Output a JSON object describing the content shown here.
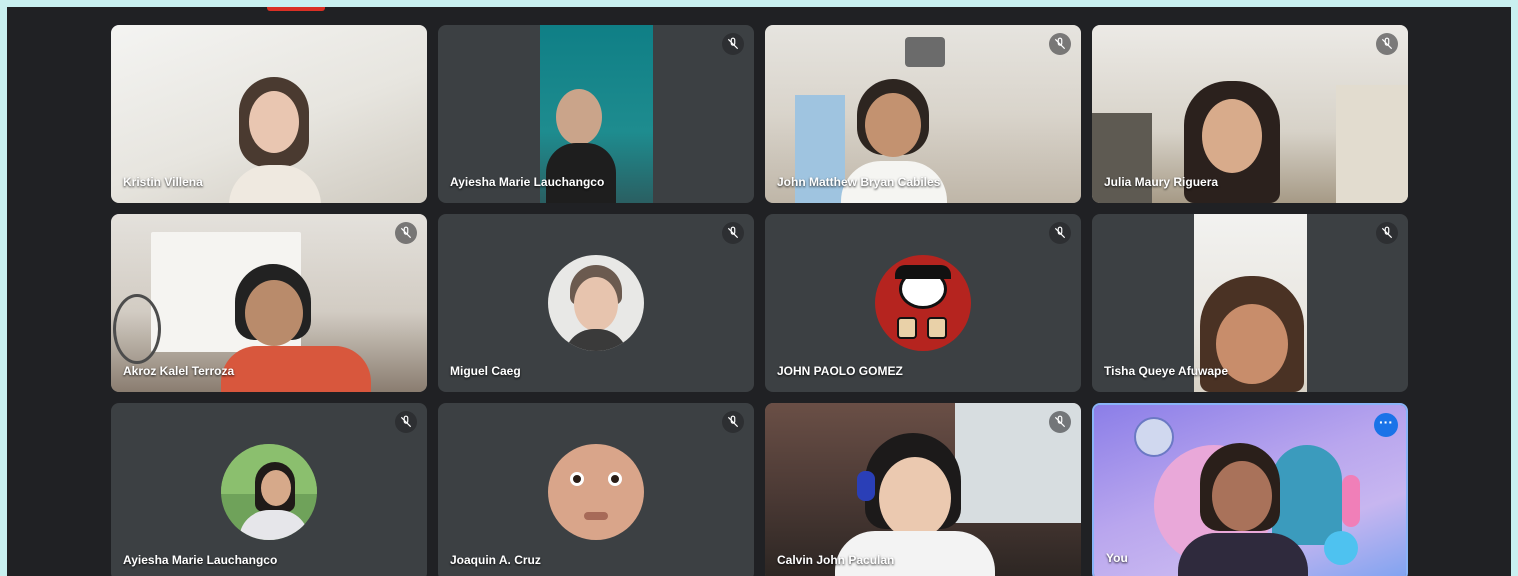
{
  "meeting": {
    "participants": [
      {
        "name": "Kristin Villena",
        "muted": false,
        "kind": "video"
      },
      {
        "name": "Ayiesha Marie Lauchangco",
        "muted": true,
        "kind": "video"
      },
      {
        "name": "John Matthew Bryan Cabiles",
        "muted": true,
        "kind": "video"
      },
      {
        "name": "Julia Maury Riguera",
        "muted": true,
        "kind": "video"
      },
      {
        "name": "Akroz Kalel Terroza",
        "muted": true,
        "kind": "video"
      },
      {
        "name": "Miguel Caeg",
        "muted": true,
        "kind": "avatar"
      },
      {
        "name": "JOHN PAOLO GOMEZ",
        "muted": true,
        "kind": "avatar"
      },
      {
        "name": "Tisha Queye Afuwape",
        "muted": true,
        "kind": "video"
      },
      {
        "name": "Ayiesha Marie Lauchangco",
        "muted": true,
        "kind": "avatar"
      },
      {
        "name": "Joaquin A. Cruz",
        "muted": true,
        "kind": "avatar"
      },
      {
        "name": "Calvin John Paculan",
        "muted": true,
        "kind": "video"
      },
      {
        "name": "You",
        "muted": false,
        "kind": "video"
      }
    ]
  },
  "colors": {
    "background": "#202124",
    "tile": "#3c4043",
    "accent_red": "#d93025",
    "accent_blue": "#1a73e8",
    "page_border": "#c9f0f0"
  },
  "icons": {
    "mute": "mic-off-icon",
    "more": "more-options-icon"
  }
}
